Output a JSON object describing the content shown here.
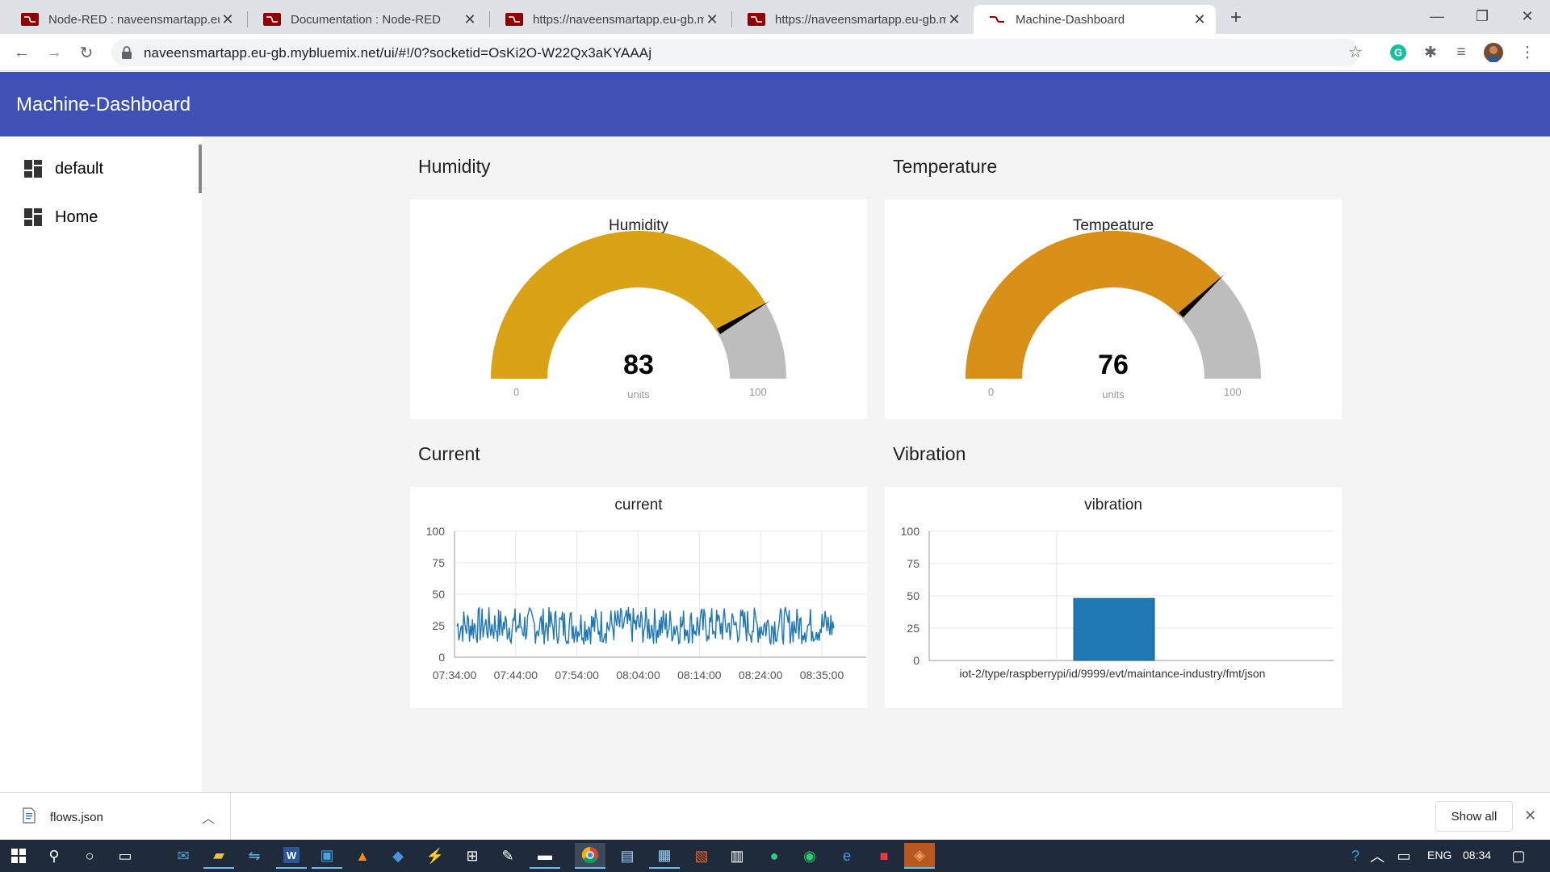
{
  "browser": {
    "tabs": [
      {
        "title": "Node-RED : naveensmartapp.eu-",
        "active": false
      },
      {
        "title": "Documentation : Node-RED",
        "active": false
      },
      {
        "title": "https://naveensmartapp.eu-gb.m",
        "active": false
      },
      {
        "title": "https://naveensmartapp.eu-gb.m",
        "active": false
      },
      {
        "title": "Machine-Dashboard",
        "active": true
      }
    ],
    "new_tab": "+",
    "url": "naveensmartapp.eu-gb.mybluemix.net/ui/#!/0?socketid=OsKi2O-W22Qx3aKYAAAj"
  },
  "app": {
    "title": "Machine-Dashboard",
    "nav": [
      {
        "label": "default",
        "icon": "dashboard-icon",
        "active": true
      },
      {
        "label": "Home",
        "icon": "dashboard-icon",
        "active": false
      }
    ],
    "groups": {
      "humidity": "Humidity",
      "temperature": "Temperature",
      "current": "Current",
      "vibration": "Vibration"
    },
    "gauges": {
      "humidity": {
        "title": "Humidity",
        "value": "83",
        "units": "units",
        "min": "0",
        "max": "100",
        "level": 83,
        "color": "#daa316"
      },
      "temperature": {
        "title": "Tempeature",
        "value": "76",
        "units": "units",
        "min": "0",
        "max": "100",
        "level": 76,
        "color": "#d99018"
      }
    }
  },
  "chart_data": [
    {
      "type": "line",
      "title": "current",
      "ylim": [
        0,
        100
      ],
      "yticks": [
        "0",
        "25",
        "50",
        "75",
        "100"
      ],
      "xticks": [
        "07:34:00",
        "07:44:00",
        "07:54:00",
        "08:04:00",
        "08:14:00",
        "08:24:00",
        "08:35:00"
      ],
      "series": [
        {
          "values_range": [
            10,
            40
          ],
          "color": "#1f77b4"
        }
      ],
      "grid": true
    },
    {
      "type": "bar",
      "title": "vibration",
      "ylim": [
        0,
        100
      ],
      "yticks": [
        "0",
        "25",
        "50",
        "75",
        "100"
      ],
      "categories": [
        "iot-2/type/raspberrypi/id/9999/evt/maintance-industry/fmt/json"
      ],
      "values": [
        48
      ],
      "color": "#1f77b4",
      "grid": true
    }
  ],
  "downloads": {
    "file": "flows.json",
    "show_all": "Show all"
  },
  "taskbar": {
    "lang": "ENG",
    "time": "08:34"
  }
}
